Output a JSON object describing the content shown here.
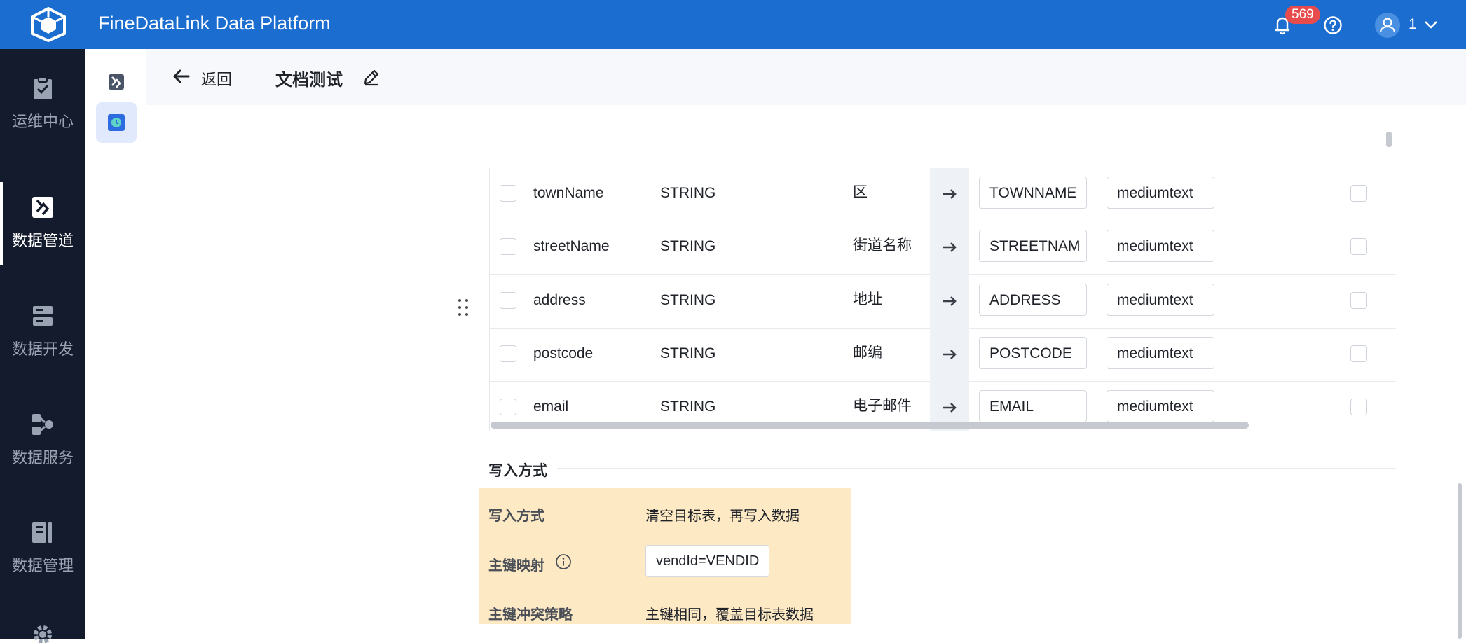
{
  "app": {
    "title": "FineDataLink Data Platform"
  },
  "topbar": {
    "notification_count": "569",
    "user_label": "1"
  },
  "nav": {
    "items": [
      {
        "label": "运维中心",
        "icon": "clipboard-check-icon",
        "active": false
      },
      {
        "label": "数据管道",
        "icon": "pipeline-icon",
        "active": true
      },
      {
        "label": "数据开发",
        "icon": "server-stack-icon",
        "active": false
      },
      {
        "label": "数据服务",
        "icon": "service-nodes-icon",
        "active": false
      },
      {
        "label": "数据管理",
        "icon": "data-management-icon",
        "active": false
      }
    ]
  },
  "header": {
    "back_label": "返回",
    "title": "文档测试"
  },
  "mapping": {
    "rows": [
      {
        "source_field": "townName",
        "source_type": "STRING",
        "description": "区",
        "target_field": "TOWNNAME",
        "target_type": "mediumtext"
      },
      {
        "source_field": "streetName",
        "source_type": "STRING",
        "description": "街道名称",
        "target_field": "STREETNAM",
        "target_type": "mediumtext"
      },
      {
        "source_field": "address",
        "source_type": "STRING",
        "description": "地址",
        "target_field": "ADDRESS",
        "target_type": "mediumtext"
      },
      {
        "source_field": "postcode",
        "source_type": "STRING",
        "description": "邮编",
        "target_field": "POSTCODE",
        "target_type": "mediumtext"
      },
      {
        "source_field": "email",
        "source_type": "STRING",
        "description": "电子邮件",
        "target_field": "EMAIL",
        "target_type": "mediumtext"
      }
    ]
  },
  "write_section": {
    "title": "写入方式",
    "write_mode_label": "写入方式",
    "write_mode_value": "清空目标表，再写入数据",
    "pk_mapping_label": "主键映射",
    "pk_mapping_value": "vendId=VENDID",
    "pk_conflict_label": "主键冲突策略",
    "pk_conflict_value": "主键相同，覆盖目标表数据"
  },
  "colors": {
    "topbar": "#1c6dd0",
    "nav_bg": "#141b2d",
    "badge": "#e84b4b",
    "highlight": "#fde9c4"
  }
}
